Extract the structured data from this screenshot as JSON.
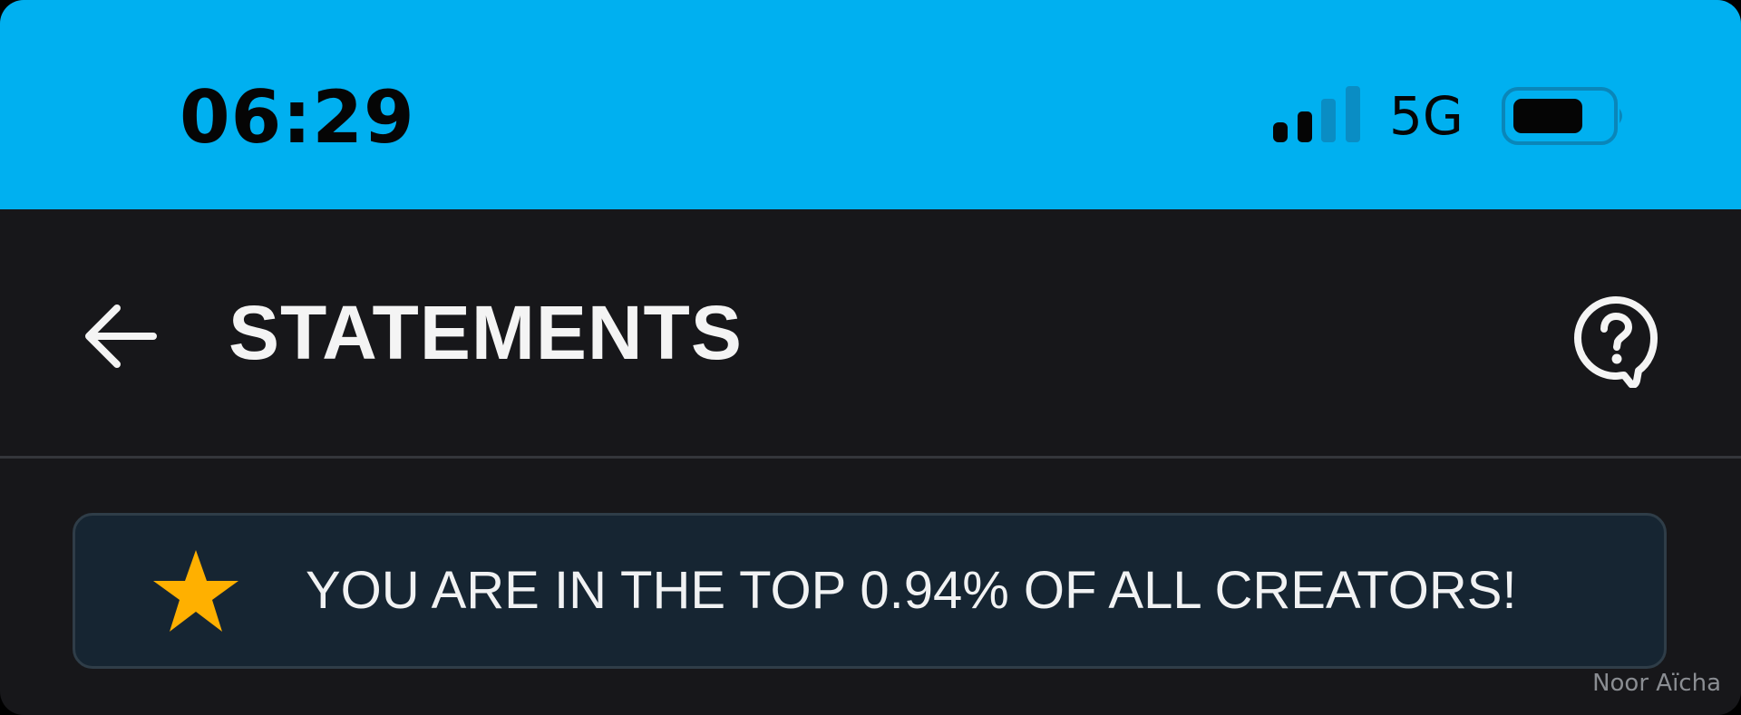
{
  "status_bar": {
    "time": "06:29",
    "network": "5G",
    "signal_icon": "cellular-signal-icon",
    "battery_icon": "battery-icon",
    "background_color": "#00b0f0"
  },
  "header": {
    "back_icon": "arrow-left-icon",
    "title": "STATEMENTS",
    "help_icon": "help-question-icon"
  },
  "banner": {
    "icon": "star-icon",
    "icon_color": "#ffb000",
    "text": "YOU ARE IN THE TOP 0.94% OF ALL CREATORS!"
  },
  "watermark": "Noor Aïcha",
  "colors": {
    "app_background": "#17171a",
    "banner_background": "#162532",
    "text": "#f1f2f3"
  }
}
